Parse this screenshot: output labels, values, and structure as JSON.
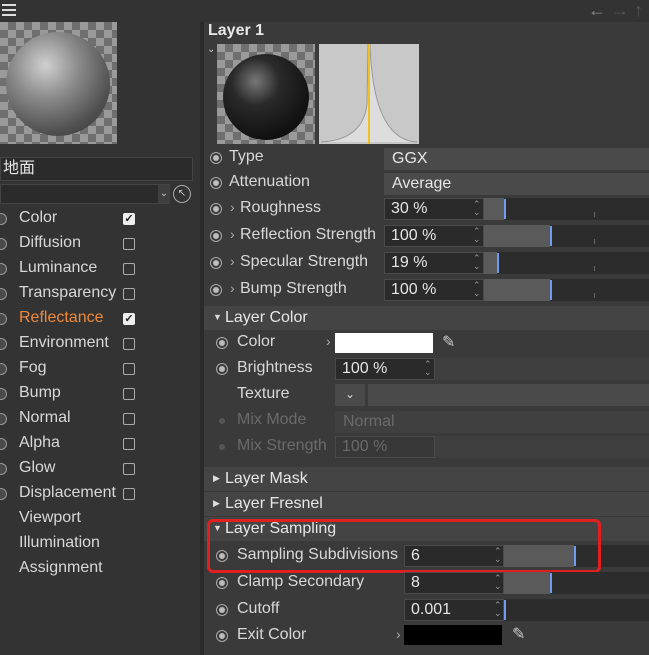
{
  "nav": {
    "back": "←",
    "forward": "→",
    "up": "↑"
  },
  "material": {
    "name": "地面"
  },
  "channels": [
    {
      "label": "Color",
      "has_checkbox": true,
      "checked": true,
      "active": false
    },
    {
      "label": "Diffusion",
      "has_checkbox": true,
      "checked": false,
      "active": false
    },
    {
      "label": "Luminance",
      "has_checkbox": true,
      "checked": false,
      "active": false
    },
    {
      "label": "Transparency",
      "has_checkbox": true,
      "checked": false,
      "active": false
    },
    {
      "label": "Reflectance",
      "has_checkbox": true,
      "checked": true,
      "active": true
    },
    {
      "label": "Environment",
      "has_checkbox": true,
      "checked": false,
      "active": false
    },
    {
      "label": "Fog",
      "has_checkbox": true,
      "checked": false,
      "active": false
    },
    {
      "label": "Bump",
      "has_checkbox": true,
      "checked": false,
      "active": false
    },
    {
      "label": "Normal",
      "has_checkbox": true,
      "checked": false,
      "active": false
    },
    {
      "label": "Alpha",
      "has_checkbox": true,
      "checked": false,
      "active": false
    },
    {
      "label": "Glow",
      "has_checkbox": true,
      "checked": false,
      "active": false
    },
    {
      "label": "Displacement",
      "has_checkbox": true,
      "checked": false,
      "active": false
    },
    {
      "label": "Viewport",
      "has_checkbox": false,
      "checked": false,
      "active": false
    },
    {
      "label": "Illumination",
      "has_checkbox": false,
      "checked": false,
      "active": false
    },
    {
      "label": "Assignment",
      "has_checkbox": false,
      "checked": false,
      "active": false
    }
  ],
  "layer": {
    "title": "Layer 1",
    "type_label": "Type",
    "type_value": "GGX",
    "attenuation_label": "Attenuation",
    "attenuation_value": "Average",
    "roughness_label": "Roughness",
    "roughness_value": "30 %",
    "roughness_level": 0.3,
    "reflection_label": "Reflection Strength",
    "reflection_value": "100 %",
    "reflection_level": 1.0,
    "specular_label": "Specular Strength",
    "specular_value": "19 %",
    "specular_level": 0.19,
    "bump_label": "Bump Strength",
    "bump_value": "100 %",
    "bump_level": 1.0
  },
  "layer_color": {
    "header": "Layer Color",
    "color_label": "Color",
    "color_value": "#ffffff",
    "brightness_label": "Brightness",
    "brightness_value": "100 %",
    "texture_label": "Texture",
    "mix_mode_label": "Mix Mode",
    "mix_mode_value": "Normal",
    "mix_strength_label": "Mix Strength",
    "mix_strength_value": "100 %"
  },
  "layer_mask": {
    "header": "Layer Mask"
  },
  "layer_fresnel": {
    "header": "Layer Fresnel"
  },
  "layer_sampling": {
    "header": "Layer Sampling",
    "subdiv_label": "Sampling Subdivisions",
    "subdiv_value": "6",
    "clamp_label": "Clamp Secondary",
    "clamp_value": "8",
    "cutoff_label": "Cutoff",
    "cutoff_value": "0.001",
    "exit_label": "Exit Color",
    "exit_value": "#000000"
  },
  "colors": {
    "accent": "#f08a3a",
    "highlight": "#e02020",
    "slider_marker": "#6e9bf0"
  }
}
